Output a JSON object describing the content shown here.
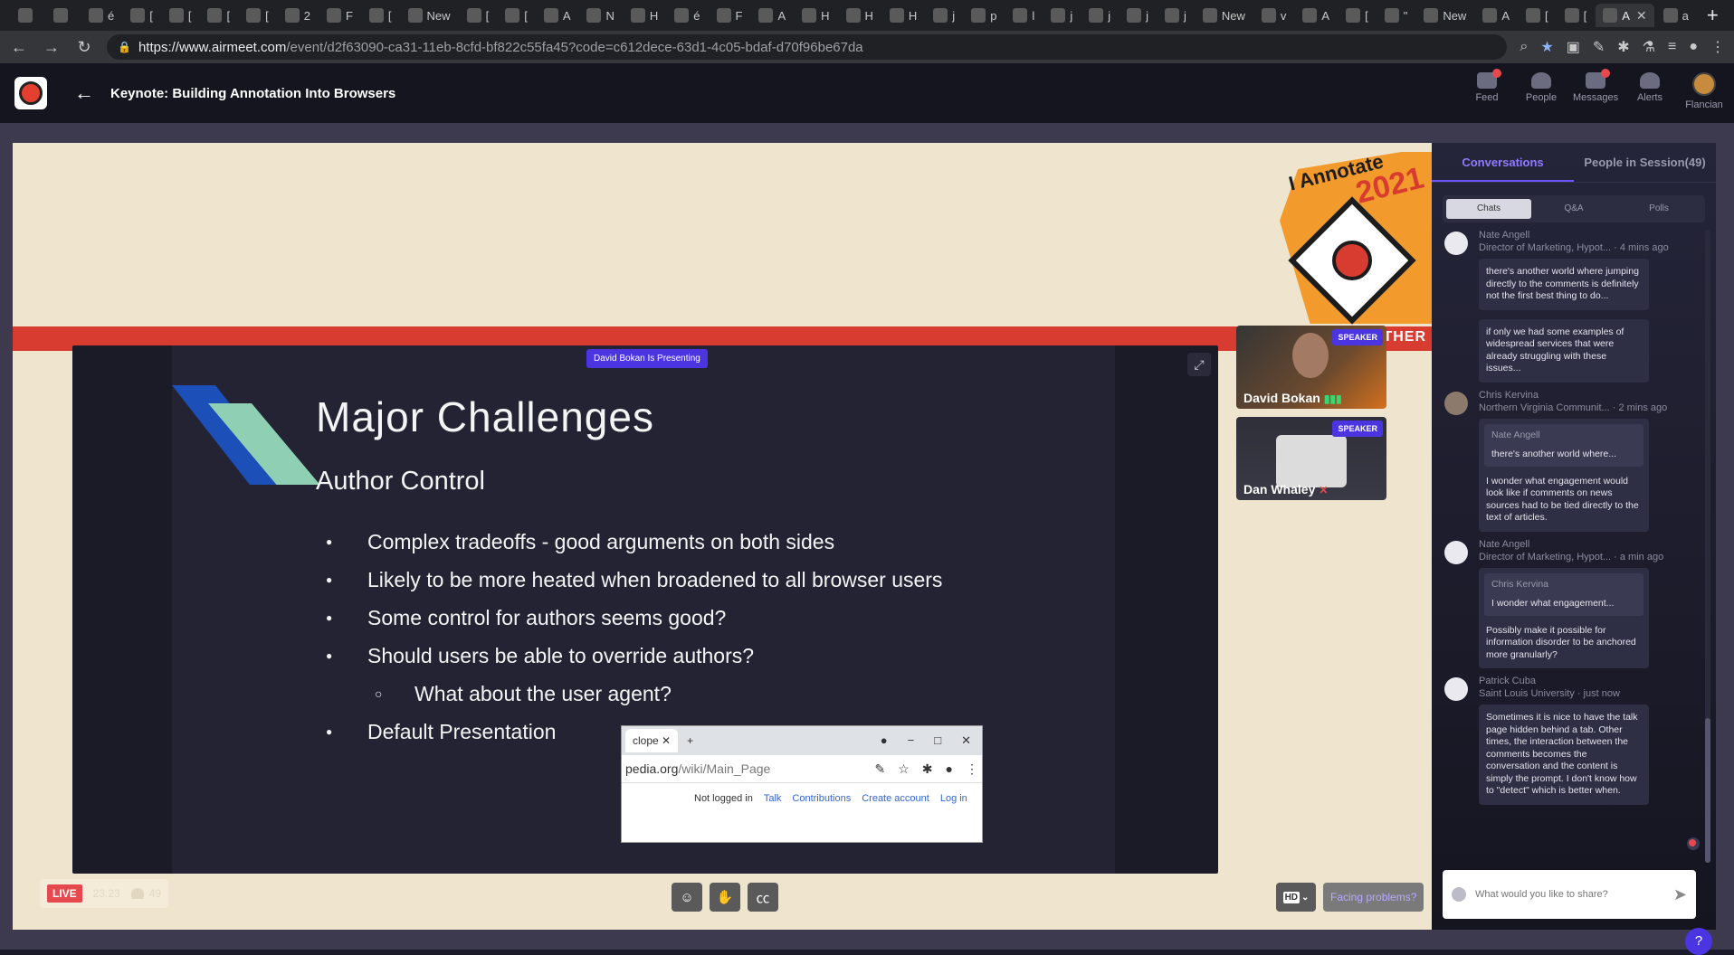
{
  "browser": {
    "tabs": [
      {
        "icon": "browser-tab-favicon",
        "label": ""
      },
      {
        "icon": "browser-tab-favicon",
        "label": ""
      },
      {
        "icon": "browser-tab-favicon",
        "label": "é"
      },
      {
        "icon": "browser-tab-favicon",
        "label": "["
      },
      {
        "icon": "browser-tab-favicon",
        "label": "["
      },
      {
        "icon": "browser-tab-favicon",
        "label": "["
      },
      {
        "icon": "browser-tab-favicon",
        "label": "["
      },
      {
        "icon": "browser-tab-favicon",
        "label": "2"
      },
      {
        "icon": "browser-tab-favicon",
        "label": "F"
      },
      {
        "icon": "browser-tab-favicon",
        "label": "["
      },
      {
        "icon": "browser-tab-favicon",
        "label": "New"
      },
      {
        "icon": "browser-tab-favicon",
        "label": "["
      },
      {
        "icon": "browser-tab-favicon",
        "label": "["
      },
      {
        "icon": "browser-tab-favicon",
        "label": "A"
      },
      {
        "icon": "browser-tab-favicon",
        "label": "N"
      },
      {
        "icon": "browser-tab-favicon",
        "label": "H"
      },
      {
        "icon": "browser-tab-favicon",
        "label": "é"
      },
      {
        "icon": "browser-tab-favicon",
        "label": "F"
      },
      {
        "icon": "browser-tab-favicon",
        "label": "A"
      },
      {
        "icon": "browser-tab-favicon",
        "label": "H"
      },
      {
        "icon": "browser-tab-favicon",
        "label": "H"
      },
      {
        "icon": "browser-tab-favicon",
        "label": "H"
      },
      {
        "icon": "browser-tab-favicon",
        "label": "j"
      },
      {
        "icon": "browser-tab-favicon",
        "label": "p"
      },
      {
        "icon": "browser-tab-favicon",
        "label": "l"
      },
      {
        "icon": "browser-tab-favicon",
        "label": "j"
      },
      {
        "icon": "browser-tab-favicon",
        "label": "j"
      },
      {
        "icon": "browser-tab-favicon",
        "label": "j"
      },
      {
        "icon": "browser-tab-favicon",
        "label": "j"
      },
      {
        "icon": "browser-tab-favicon",
        "label": "New"
      },
      {
        "icon": "browser-tab-favicon",
        "label": "v"
      },
      {
        "icon": "browser-tab-favicon",
        "label": "A"
      },
      {
        "icon": "browser-tab-favicon",
        "label": "["
      },
      {
        "icon": "browser-tab-favicon",
        "label": "\""
      },
      {
        "icon": "browser-tab-favicon",
        "label": "New"
      },
      {
        "icon": "browser-tab-favicon",
        "label": "A"
      },
      {
        "icon": "browser-tab-favicon",
        "label": "["
      },
      {
        "icon": "browser-tab-favicon",
        "label": "["
      },
      {
        "icon": "browser-tab-favicon",
        "label": "A",
        "active": true
      },
      {
        "icon": "browser-tab-favicon",
        "label": "a"
      }
    ],
    "url_host": "https://www.airmeet.com",
    "url_path": "/event/d2f63090-ca31-11eb-8cfd-bf822c55fa45?code=c612dece-63d1-4c05-bdaf-d70f96be67da"
  },
  "app": {
    "title": "Keynote: Building Annotation Into Browsers",
    "nav": [
      {
        "key": "feed",
        "label": "Feed",
        "has_badge": true
      },
      {
        "key": "people",
        "label": "People",
        "has_badge": false
      },
      {
        "key": "messages",
        "label": "Messages",
        "has_badge": true
      },
      {
        "key": "alerts",
        "label": "Alerts",
        "has_badge": false
      },
      {
        "key": "profile",
        "label": "Flancian",
        "has_badge": false
      }
    ]
  },
  "stage": {
    "banner_badge_title": "I Annotate",
    "banner_badge_year": "2021",
    "band_text": "GETHER",
    "presenting_label": "David Bokan Is Presenting",
    "slide": {
      "title": "Major Challenges",
      "subtitle": "Author Control",
      "bullets": [
        {
          "text": "Complex tradeoffs - good arguments on both sides",
          "level": 1
        },
        {
          "text": "Likely to be more heated when broadened to all browser users",
          "level": 1
        },
        {
          "text": "Some control for authors seems good?",
          "level": 1
        },
        {
          "text": "Should users be able to override authors?",
          "level": 1
        },
        {
          "text": "What about the user agent?",
          "level": 2
        },
        {
          "text": "Default Presentation",
          "level": 1
        }
      ],
      "embedded_screenshot": {
        "tab_label": "clope",
        "url_host": "pedia.org",
        "url_path": "/wiki/Main_Page",
        "links": [
          "Not logged in",
          "Talk",
          "Contributions",
          "Create account",
          "Log in"
        ]
      }
    },
    "speakers": [
      {
        "name": "David Bokan",
        "badge": "SPEAKER",
        "mic": "on"
      },
      {
        "name": "Dan Whaley",
        "badge": "SPEAKER",
        "mic": "muted"
      }
    ],
    "live_label": "LIVE",
    "live_time": "23:23",
    "attendee_count": "49",
    "hd_label": "HD",
    "facing_problems": "Facing problems?"
  },
  "panel": {
    "tabs": [
      "Conversations",
      "People in Session(49)"
    ],
    "subtabs": [
      "Chats",
      "Q&A",
      "Polls"
    ],
    "messages": [
      {
        "name": "Nate Angell",
        "meta": "Director of Marketing, Hypot... · 4 mins ago",
        "bubbles": [
          {
            "text": "there's another world where jumping directly to the comments is definitely not the first best thing to do..."
          },
          {
            "text": "if only we had some examples of widespread services that were already struggling with these issues..."
          }
        ]
      },
      {
        "name": "Chris Kervina",
        "meta": "Northern Virginia Communit... · 2 mins ago",
        "bubbles": [
          {
            "reply_name": "Nate Angell",
            "reply_text": "there's another world where...",
            "text": "I wonder what engagement would look like if comments on news sources had to be tied directly to the text of articles."
          }
        ]
      },
      {
        "name": "Nate Angell",
        "meta": "Director of Marketing, Hypot... · a min ago",
        "bubbles": [
          {
            "reply_name": "Chris Kervina",
            "reply_text": "I wonder what engagement...",
            "text": "Possibly make it possible for information disorder to be anchored more granularly?"
          }
        ]
      },
      {
        "name": "Patrick Cuba",
        "meta": "Saint Louis University · just now",
        "bubbles": [
          {
            "text": "Sometimes it is nice to have the talk page hidden behind a tab. Other times, the interaction between the comments becomes the conversation and the content is simply the prompt. I don't know how to \"detect\" which is better when."
          }
        ]
      }
    ],
    "composer_placeholder": "What would you like to share?"
  }
}
